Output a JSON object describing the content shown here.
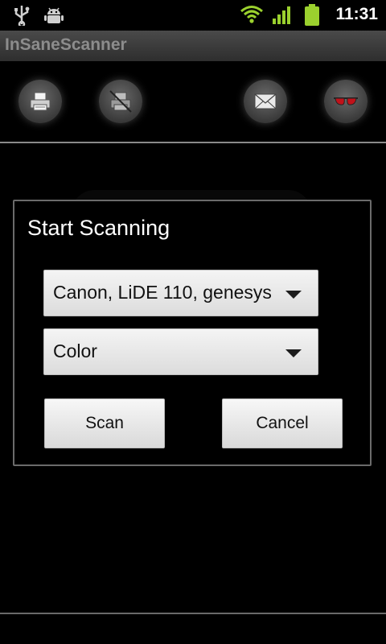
{
  "status_bar": {
    "time": "11:31",
    "left_icons": [
      "usb-icon",
      "android-debug-icon"
    ],
    "right_icons": [
      "wifi-icon",
      "signal-icon",
      "battery-icon"
    ]
  },
  "app": {
    "title": "InSaneScanner"
  },
  "toolbar": {
    "buttons": [
      "printer-icon",
      "printer-disabled-icon",
      "mail-icon",
      "glasses-icon"
    ]
  },
  "dialog": {
    "title": "Start Scanning",
    "device_select": {
      "value": "Canon, LiDE 110, genesys"
    },
    "mode_select": {
      "value": "Color"
    },
    "scan_label": "Scan",
    "cancel_label": "Cancel"
  },
  "colors": {
    "background": "#000000",
    "titlebar": "#3a3a3a",
    "title_text": "#8c8c8c",
    "button_face": "#e6e6e6"
  }
}
